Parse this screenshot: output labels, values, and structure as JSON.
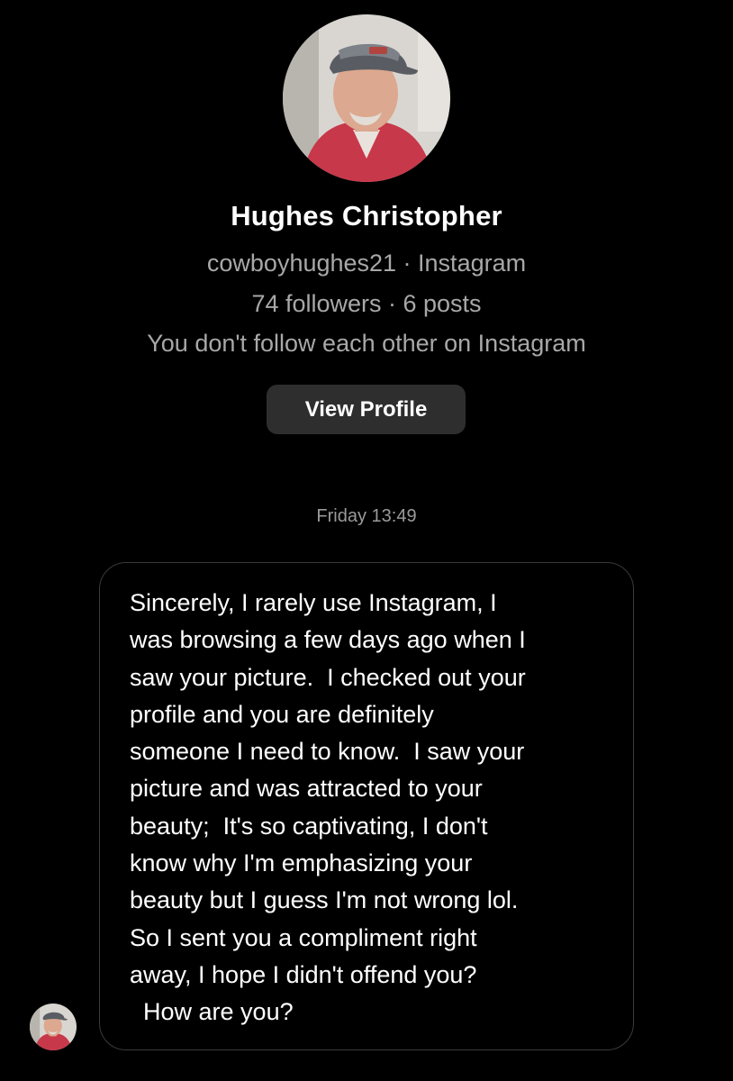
{
  "profile": {
    "name": "Hughes Christopher",
    "handle_line": "cowboyhughes21 · Instagram",
    "stats_line": "74 followers · 6 posts",
    "follow_status": "You don't follow each other on Instagram",
    "view_profile_label": "View Profile",
    "avatar_icon": "profile-photo"
  },
  "conversation": {
    "timestamp": "Friday 13:49",
    "messages": [
      {
        "sender": "other",
        "text": "Sincerely, I rarely use Instagram, I\nwas browsing a few days ago when I\nsaw your picture.  I checked out your\nprofile and you are definitely\nsomeone I need to know.  I saw your\npicture and was attracted to your\nbeauty;  It's so captivating, I don't\nknow why I'm emphasizing your\nbeauty but I guess I'm not wrong lol.\nSo I sent you a compliment right\naway, I hope I didn't offend you?\n  How are you?"
      }
    ]
  },
  "colors": {
    "background": "#000000",
    "primary_text": "#ffffff",
    "secondary_text": "#a8a8a8",
    "button_bg": "#2e2e2e",
    "bubble_border": "#3a3a3a"
  }
}
